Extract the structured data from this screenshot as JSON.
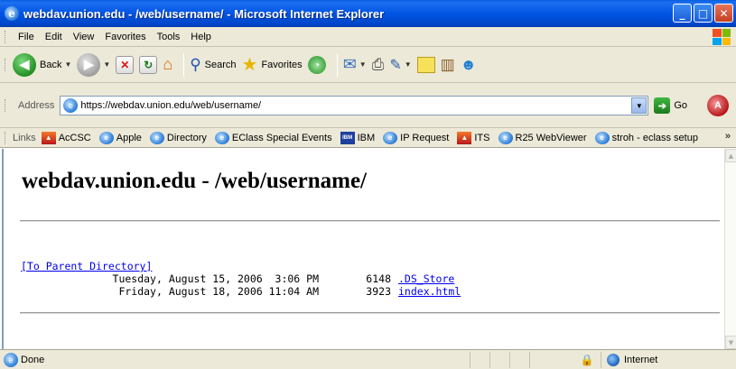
{
  "window": {
    "title": "webdav.union.edu - /web/username/ - Microsoft Internet Explorer",
    "buttons": {
      "minimize": "_",
      "maximize": "□",
      "close": "✕"
    }
  },
  "menu": [
    "File",
    "Edit",
    "View",
    "Favorites",
    "Tools",
    "Help"
  ],
  "toolbar": {
    "back_label": "Back",
    "search_label": "Search",
    "favorites_label": "Favorites"
  },
  "address": {
    "label": "Address",
    "url": "https://webdav.union.edu/web/username/",
    "go_label": "Go"
  },
  "links": {
    "label": "Links",
    "items": [
      {
        "label": "AcCSC",
        "icon": "union-icon"
      },
      {
        "label": "Apple",
        "icon": "ie-page-icon"
      },
      {
        "label": "Directory",
        "icon": "ie-page-icon"
      },
      {
        "label": "EClass Special Events",
        "icon": "ie-page-icon"
      },
      {
        "label": "IBM",
        "icon": "ibm-icon"
      },
      {
        "label": "IP Request",
        "icon": "ie-page-icon"
      },
      {
        "label": "ITS",
        "icon": "union-icon"
      },
      {
        "label": "R25 WebViewer",
        "icon": "ie-page-icon"
      },
      {
        "label": "stroh - eclass setup",
        "icon": "ie-page-icon"
      }
    ]
  },
  "page": {
    "heading": "webdav.union.edu - /web/username/",
    "parent_link": "[To Parent Directory]",
    "files": [
      {
        "date": "Tuesday, August 15, 2006  3:06 PM",
        "size": "6148",
        "name": ".DS_Store"
      },
      {
        "date": "Friday, August 18, 2006 11:04 AM",
        "size": "3923",
        "name": "index.html"
      }
    ]
  },
  "status": {
    "text": "Done",
    "zone": "Internet"
  }
}
